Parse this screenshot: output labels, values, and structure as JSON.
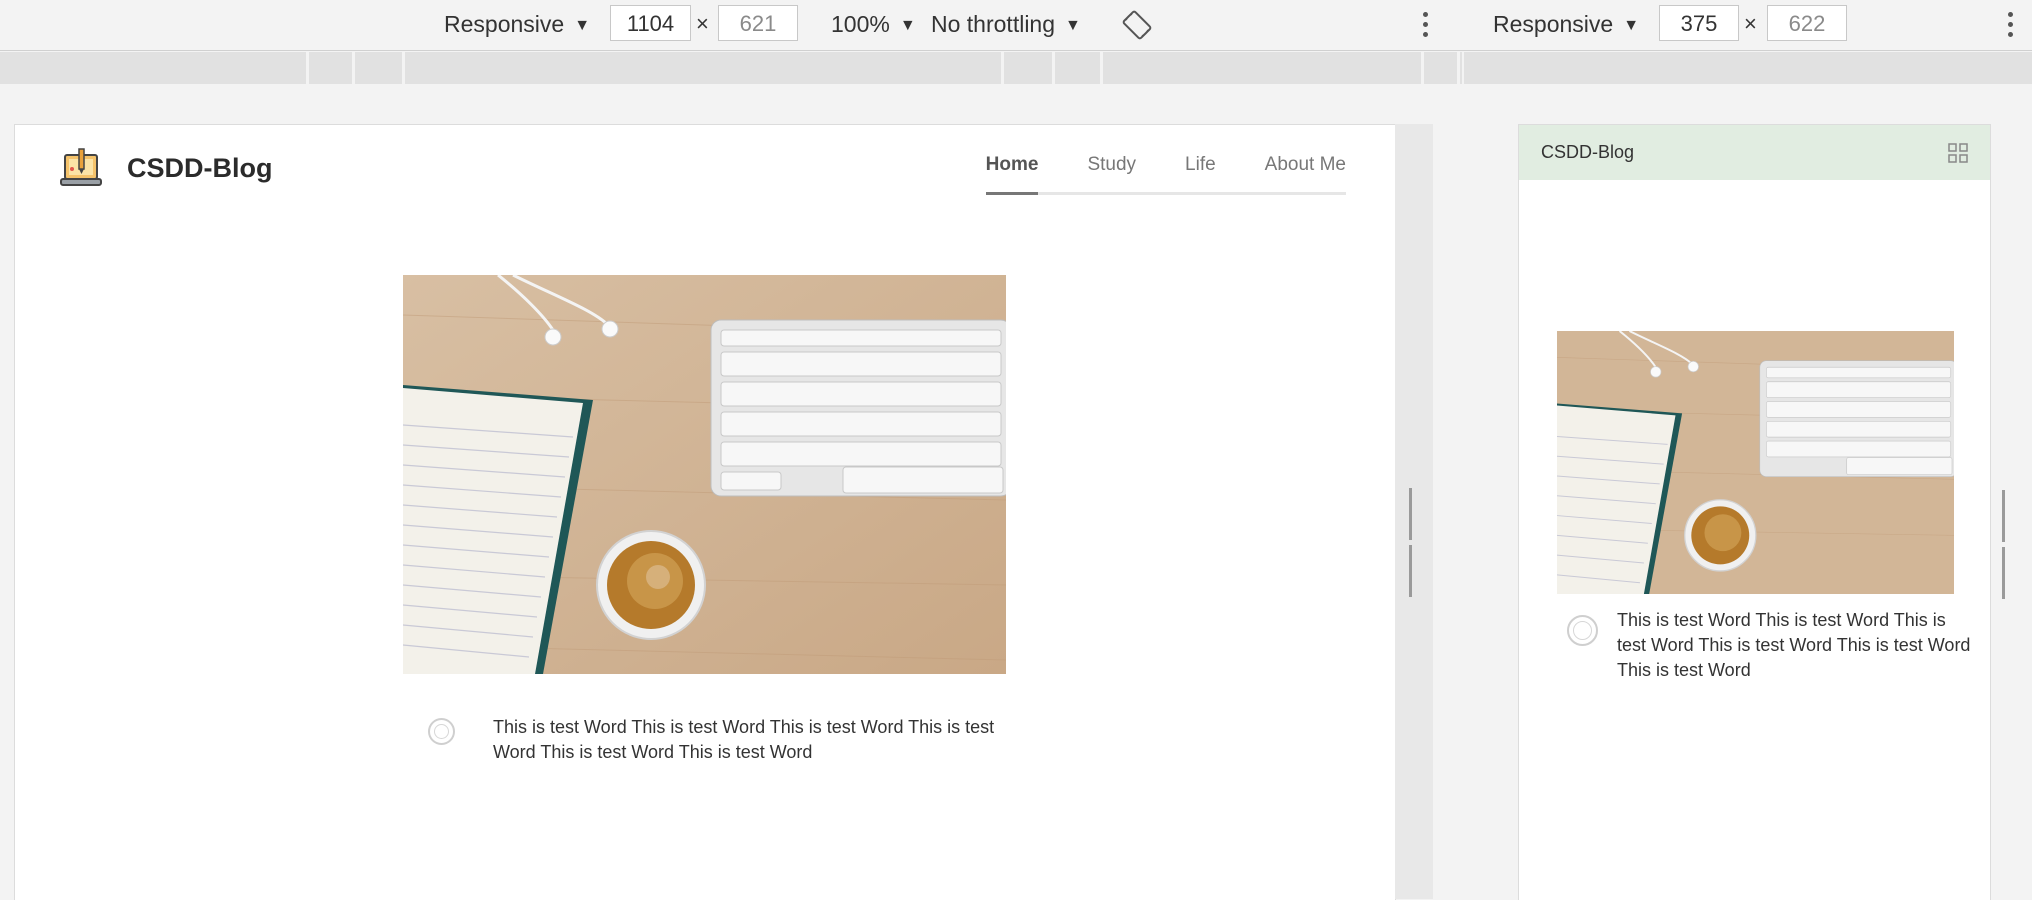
{
  "toolbar_left": {
    "device": "Responsive",
    "width": "1104",
    "height": "621",
    "times": "×",
    "zoom": "100%",
    "throttling": "No throttling"
  },
  "toolbar_right": {
    "device": "Responsive",
    "width": "375",
    "height": "622",
    "times": "×"
  },
  "icons": {
    "dropdown": "▼",
    "rotate": "rotate-icon",
    "more": "kebab-icon",
    "grid": "grid-menu-icon",
    "logo": "laptop-pen-logo-icon"
  },
  "site": {
    "brand": "CSDD-Blog",
    "nav": [
      "Home",
      "Study",
      "Life",
      "About Me"
    ],
    "active_nav": "Home",
    "post_text": "This is test Word This is test Word This is test Word This is test Word This is test Word This is test Word"
  },
  "mobile": {
    "brand": "CSDD-Blog",
    "post_text": "This is test Word This is test Word This is test Word This is test Word This is test Word This is test Word",
    "header_color": "#e1ede1"
  }
}
